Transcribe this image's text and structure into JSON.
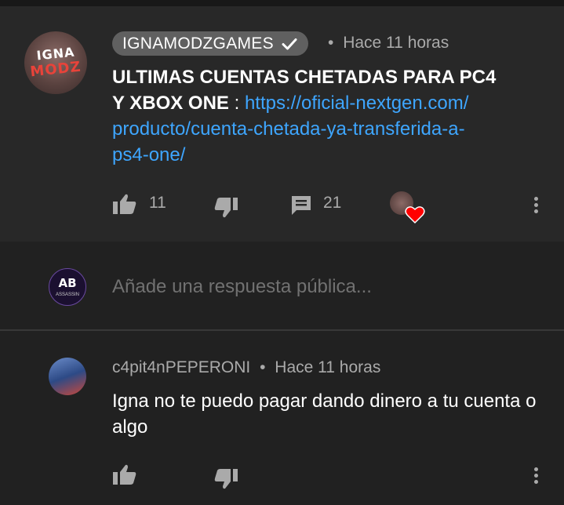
{
  "main_comment": {
    "avatar_text_line1": "IGNA",
    "avatar_text_line2": "MODZ",
    "author": "IGNAMODZGAMES",
    "separator": "•",
    "time": "Hace 11 horas",
    "title_line1": "ULTIMAS CUENTAS CHETADAS PARA PC4",
    "title_line2": "Y XBOX ONE",
    "colon": " : ",
    "link_line1": "https://oficial-nextgen.com/",
    "link_line2": "producto/cuenta-chetada-ya-transferida-a-",
    "link_line3": "ps4-one/",
    "likes": "11",
    "replies": "21",
    "liked_by_creator_icon": "heart-icon"
  },
  "reply_input": {
    "avatar_text": "AB",
    "avatar_subtext": "ASSASSIN",
    "placeholder": "Añade una respuesta pública..."
  },
  "reply_comment": {
    "author": "c4pit4nPEPERONI",
    "separator": "•",
    "time": "Hace 11 horas",
    "text": "Igna no te puedo pagar dando dinero a tu cuenta o algo"
  },
  "colors": {
    "background": "#212121",
    "card": "#282828",
    "link": "#3ea6ff",
    "secondary_text": "#aaaaaa",
    "heart": "#ff0000"
  }
}
